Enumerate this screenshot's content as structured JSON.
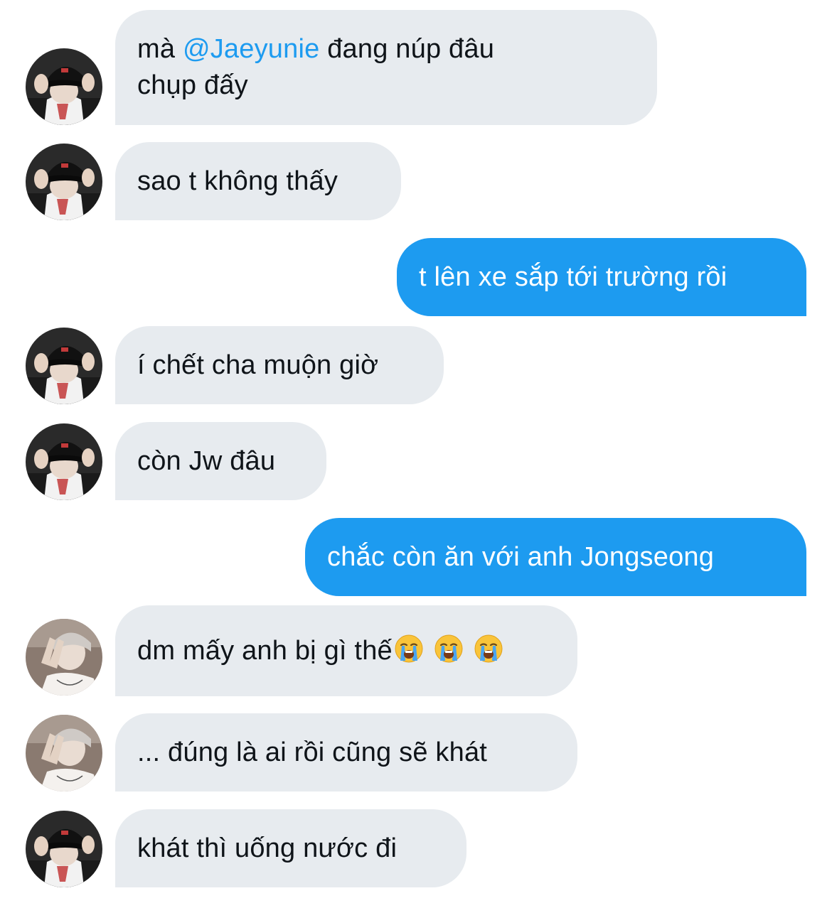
{
  "conversation": {
    "messages": [
      {
        "side": "in",
        "avatar": "avatar-cap",
        "prefix": "mà ",
        "mention": "@Jaeyunie",
        "suffix": " đang núp đâu",
        "line2": "chụp đấy"
      },
      {
        "side": "in",
        "avatar": "avatar-cap",
        "text": "sao t không thấy"
      },
      {
        "side": "out",
        "text": "t lên xe sắp tới trường rồi"
      },
      {
        "side": "in",
        "avatar": "avatar-cap",
        "text": "í chết cha muộn giờ"
      },
      {
        "side": "in",
        "avatar": "avatar-cap",
        "text": "còn Jw đâu"
      },
      {
        "side": "out",
        "text": "chắc còn ăn với anh Jongseong"
      },
      {
        "side": "in",
        "avatar": "avatar-peace",
        "text": "dm mấy anh bị gì thế",
        "emojis": [
          "loudly-crying-face",
          "loudly-crying-face",
          "loudly-crying-face"
        ]
      },
      {
        "side": "in",
        "avatar": "avatar-peace",
        "text": "... đúng là ai rồi cũng sẽ khát"
      },
      {
        "side": "in",
        "avatar": "avatar-cap",
        "text": "khát thì uống nước đi"
      }
    ]
  },
  "colors": {
    "incoming_bubble": "#e7ebef",
    "outgoing_bubble": "#1d9bf0",
    "mention": "#1d9bf0",
    "text": "#0f1419"
  }
}
